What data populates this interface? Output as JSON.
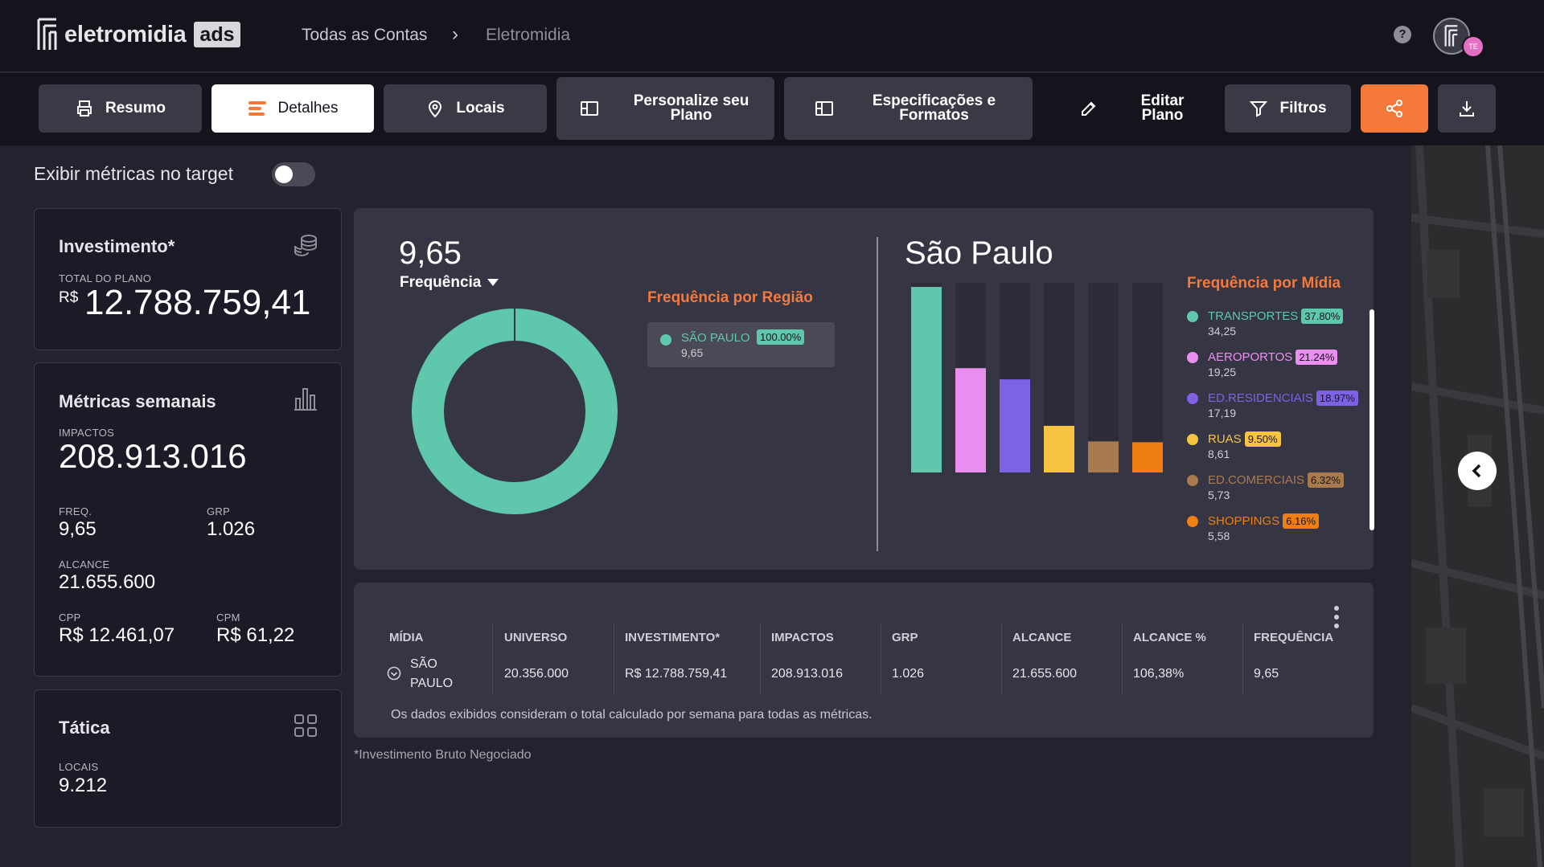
{
  "header": {
    "logo_text": "eletromidia",
    "logo_badge": "ads",
    "breadcrumb": [
      "Todas as Contas",
      "Eletromidia"
    ],
    "breadcrumb_sep": "›",
    "help_label": "?",
    "avatar_initials": "TE"
  },
  "toolbar": {
    "resumo": "Resumo",
    "detalhes": "Detalhes",
    "locais": "Locais",
    "personalize": "Personalize seu Plano",
    "especificacoes": "Especificações e Formatos",
    "editar": "Editar Plano",
    "filtros": "Filtros"
  },
  "toggle": {
    "label": "Exibir métricas no target",
    "on": false
  },
  "investimento": {
    "title": "Investimento*",
    "sub_label": "TOTAL DO PLANO",
    "currency": "R$",
    "value": "12.788.759,41"
  },
  "metricas": {
    "title": "Métricas semanais",
    "impactos_label": "IMPACTOS",
    "impactos": "208.913.016",
    "freq_label": "FREQ.",
    "freq": "9,65",
    "grp_label": "GRP",
    "grp": "1.026",
    "alcance_label": "ALCANCE",
    "alcance": "21.655.600",
    "cpp_label": "CPP",
    "cpp": "R$ 12.461,07",
    "cpm_label": "CPM",
    "cpm": "R$ 61,22"
  },
  "tatica": {
    "title": "Tática",
    "locais_label": "LOCAIS",
    "locais": "9.212"
  },
  "frequencia": {
    "value": "9,65",
    "selector": "Frequência",
    "regiao_title": "Frequência por Região",
    "regiao": {
      "name": "SÃO PAULO",
      "pct": "100.00%",
      "value": "9,65"
    },
    "city": "São Paulo",
    "midia_title": "Frequência por Mídia"
  },
  "chart_data": {
    "type": "bar",
    "categories": [
      "TRANSPORTES",
      "AEROPORTOS",
      "ED.RESIDENCIAIS",
      "RUAS",
      "ED.COMERCIAIS",
      "SHOPPINGS"
    ],
    "values": [
      34.25,
      19.25,
      17.19,
      8.61,
      5.73,
      5.58
    ],
    "labels": [
      "34,25",
      "19,25",
      "17,19",
      "8,61",
      "5,73",
      "5,58"
    ],
    "percents": [
      "37.80%",
      "21.24%",
      "18.97%",
      "9.50%",
      "6.32%",
      "6.16%"
    ],
    "colors": [
      "#5ec7ac",
      "#ea8ff0",
      "#7d62e6",
      "#f6c343",
      "#a97a4e",
      "#f07f12"
    ],
    "ylim": [
      0,
      35
    ]
  },
  "donut": {
    "share": 1.0,
    "color": "#5ec7ac"
  },
  "table": {
    "headers": [
      "MÍDIA",
      "UNIVERSO",
      "INVESTIMENTO*",
      "IMPACTOS",
      "GRP",
      "ALCANCE",
      "ALCANCE %",
      "FREQUÊNCIA"
    ],
    "row": [
      "SÃO PAULO",
      "20.356.000",
      "R$ 12.788.759,41",
      "208.913.016",
      "1.026",
      "21.655.600",
      "106,38%",
      "9,65"
    ],
    "note": "Os dados exibidos consideram o total calculado por semana para todas as métricas."
  },
  "footnote": "*Investimento Bruto Negociado",
  "colors": {
    "accent": "#f5793b",
    "panel": "#363544",
    "header": "#15141c"
  }
}
